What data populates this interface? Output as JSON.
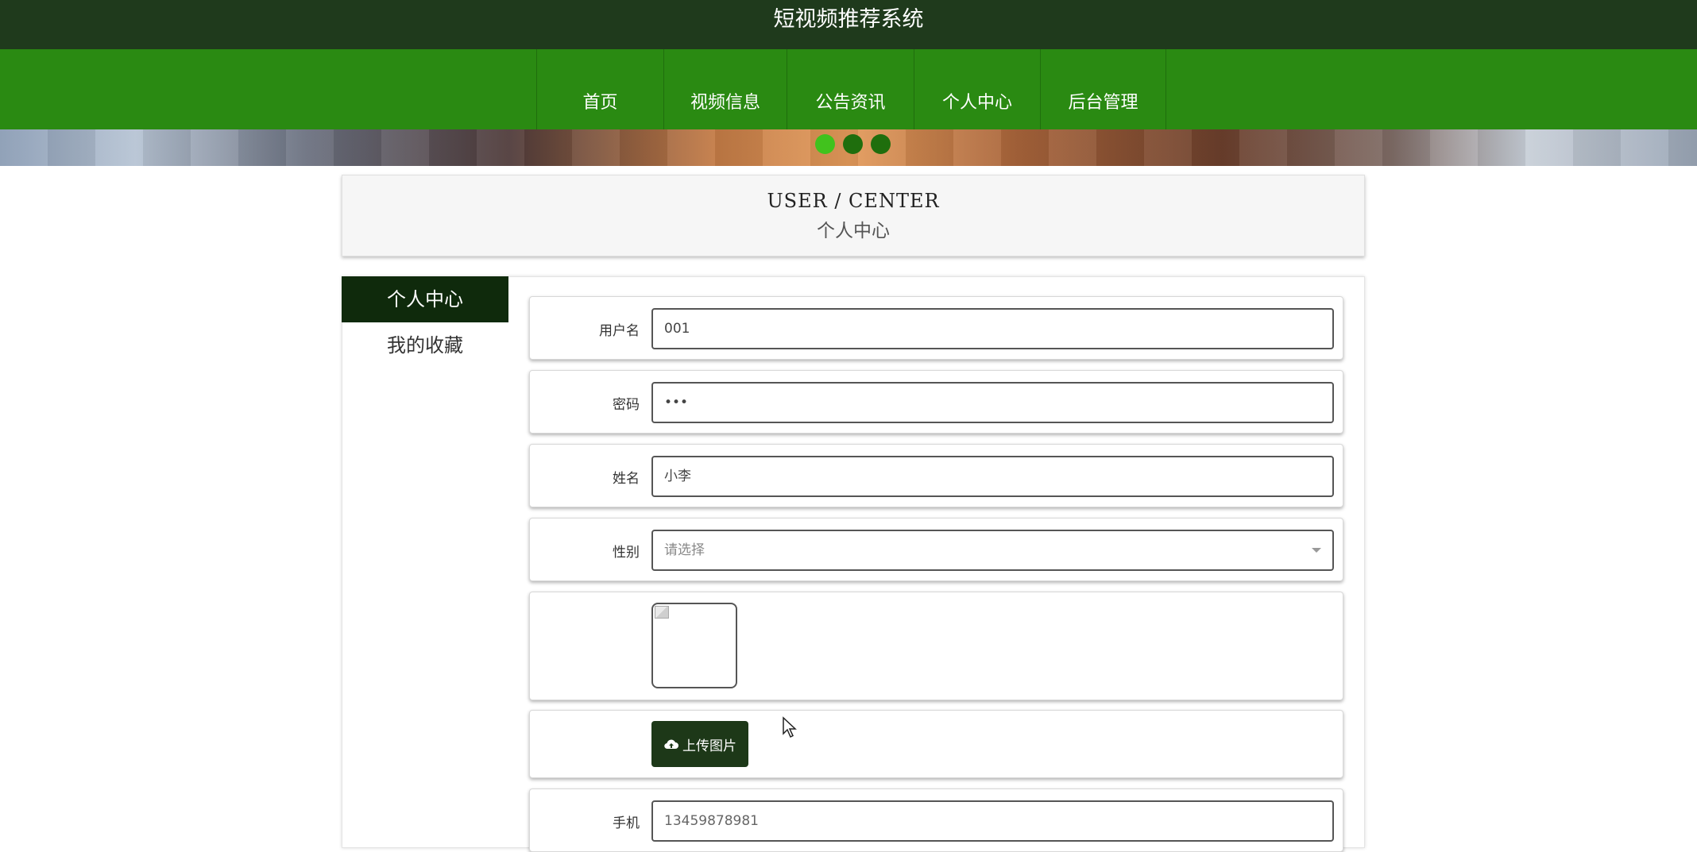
{
  "app_title": "短视频推荐系统",
  "nav": {
    "items": [
      {
        "label": "首页"
      },
      {
        "label": "视频信息"
      },
      {
        "label": "公告资讯"
      },
      {
        "label": "个人中心"
      },
      {
        "label": "后台管理"
      }
    ]
  },
  "header": {
    "title_en": "USER / CENTER",
    "title_cn": "个人中心"
  },
  "sidebar": {
    "items": [
      {
        "label": "个人中心",
        "active": true
      },
      {
        "label": "我的收藏",
        "active": false
      }
    ]
  },
  "form": {
    "username": {
      "label": "用户名",
      "value": "001"
    },
    "password": {
      "label": "密码",
      "value": "•••"
    },
    "name": {
      "label": "姓名",
      "value": "小李"
    },
    "gender": {
      "label": "性别",
      "placeholder": "请选择"
    },
    "upload": {
      "label": "上传图片"
    },
    "phone": {
      "label": "手机",
      "value": "13459878981"
    }
  },
  "colors": {
    "top_bar": "#1f3a1c",
    "nav": "#2a8a12",
    "sidebar_active": "#0f2a0c",
    "upload_button": "#1d3818"
  },
  "icons": {
    "upload": "cloud-upload-icon",
    "cursor": "mouse-pointer-icon"
  }
}
